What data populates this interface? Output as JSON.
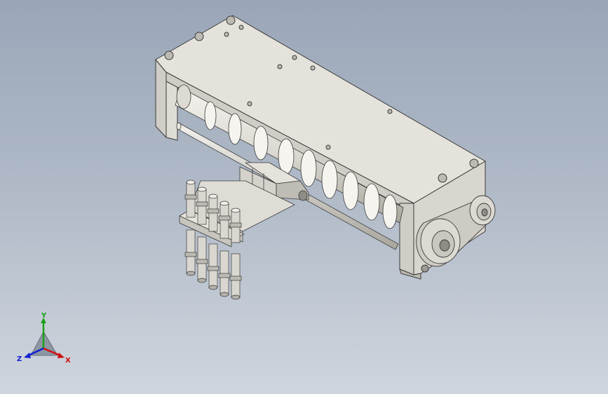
{
  "viewport": {
    "background_top": "#9aa6b8",
    "background_bottom": "#cfd5dd",
    "model_color": "#e6e4dc",
    "model_shade": "#bfbdb4",
    "edge_color": "#3a3a3a"
  },
  "model": {
    "parts": [
      "housing",
      "screw-rotor",
      "guide-rod",
      "pulley-belt-drive",
      "nozzle-block",
      "fittings"
    ]
  },
  "triad": {
    "x_label": "X",
    "y_label": "Y",
    "z_label": "Z",
    "x_color": "#d01010",
    "y_color": "#1aa01a",
    "z_color": "#1020d0"
  }
}
